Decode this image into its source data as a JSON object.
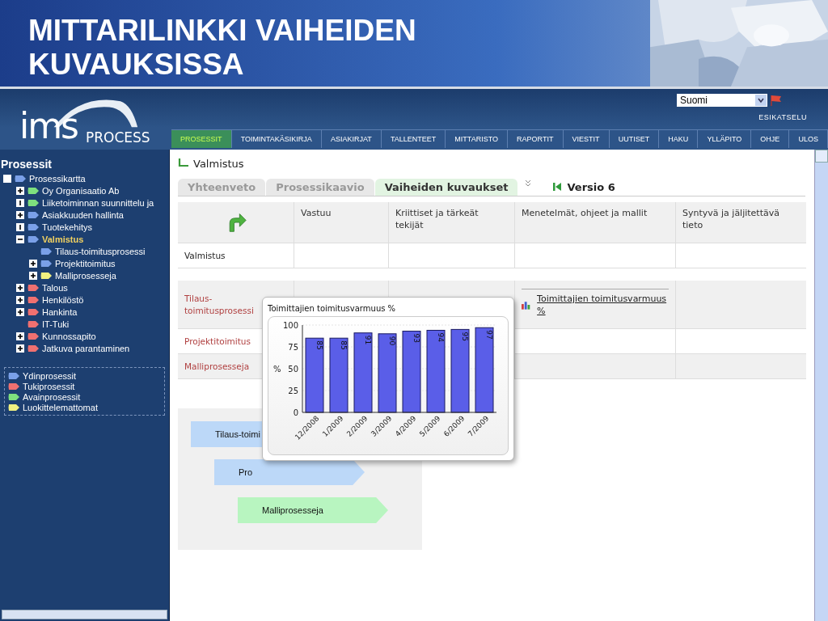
{
  "slide": {
    "title": "MITTARILINKKI VAIHEIDEN KUVAUKSISSA"
  },
  "header": {
    "logo_main": "ims",
    "logo_sub": "PROCESS",
    "language": "Suomi",
    "preview_link": "ESIKATSELU"
  },
  "nav": [
    {
      "label": "PROSESSIT",
      "selected": true
    },
    {
      "label": "TOIMINTAKÄSIKIRJA",
      "selected": false
    },
    {
      "label": "ASIAKIRJAT",
      "selected": false
    },
    {
      "label": "TALLENTEET",
      "selected": false
    },
    {
      "label": "MITTARISTO",
      "selected": false
    },
    {
      "label": "RAPORTIT",
      "selected": false
    },
    {
      "label": "VIESTIT",
      "selected": false
    },
    {
      "label": "UUTISET",
      "selected": false
    },
    {
      "label": "HAKU",
      "selected": false
    },
    {
      "label": "YLLÄPITO",
      "selected": false
    },
    {
      "label": "OHJE",
      "selected": false
    },
    {
      "label": "ULOS",
      "selected": false
    }
  ],
  "sidebar": {
    "title": "Prosessit",
    "tree": [
      {
        "label": "Prosessikartta",
        "kind": "box",
        "color": "#7aa0e8",
        "selected": false,
        "children": [
          {
            "label": "Oy Organisaatio Ab",
            "kind": "plus",
            "color": "#7ee07e",
            "selected": false
          },
          {
            "label": "Liiketoiminnan suunnittelu ja",
            "kind": "line",
            "color": "#7ee07e",
            "selected": false
          },
          {
            "label": "Asiakkuuden hallinta",
            "kind": "plus",
            "color": "#7aa0e8",
            "selected": false
          },
          {
            "label": "Tuotekehitys",
            "kind": "line",
            "color": "#7aa0e8",
            "selected": false
          },
          {
            "label": "Valmistus",
            "kind": "minus",
            "color": "#7aa0e8",
            "selected": true,
            "children": [
              {
                "label": "Tilaus-toimitusprosessi",
                "kind": "leaf",
                "color": "#7aa0e8",
                "selected": false
              },
              {
                "label": "Projektitoimitus",
                "kind": "plus",
                "color": "#7aa0e8",
                "selected": false
              },
              {
                "label": "Malliprosesseja",
                "kind": "plus",
                "color": "#f0f080",
                "selected": false
              }
            ]
          },
          {
            "label": "Talous",
            "kind": "plus",
            "color": "#f07070",
            "selected": false
          },
          {
            "label": "Henkilöstö",
            "kind": "plus",
            "color": "#f07070",
            "selected": false
          },
          {
            "label": "Hankinta",
            "kind": "plus",
            "color": "#f07070",
            "selected": false
          },
          {
            "label": "IT-Tuki",
            "kind": "leaf",
            "color": "#f07070",
            "selected": false
          },
          {
            "label": "Kunnossapito",
            "kind": "plus",
            "color": "#f07070",
            "selected": false
          },
          {
            "label": "Jatkuva parantaminen",
            "kind": "plus",
            "color": "#f07070",
            "selected": false
          }
        ]
      }
    ],
    "legend": [
      {
        "label": "Ydinprosessit",
        "color": "#7aa0e8"
      },
      {
        "label": "Tukiprosessit",
        "color": "#f07070"
      },
      {
        "label": "Avainprosessit",
        "color": "#7ee07e"
      },
      {
        "label": "Luokittelemattomat",
        "color": "#f0f080"
      }
    ]
  },
  "page": {
    "title": "Valmistus",
    "tabs": [
      {
        "label": "Yhteenveto",
        "selected": false
      },
      {
        "label": "Prosessikaavio",
        "selected": false
      },
      {
        "label": "Vaiheiden kuvaukset",
        "selected": true
      }
    ],
    "version": "Versio 6",
    "table": {
      "columns": [
        "Vastuu",
        "Kriittiset ja tärkeät tekijät",
        "Menetelmät, ohjeet ja mallit",
        "Syntyvä ja jäljitettävä tieto"
      ],
      "rows": [
        {
          "name": "Valmistus",
          "kind": "parent"
        },
        {
          "name": "Tilaus-toimitusprosessi",
          "kind": "child",
          "link": "Toimittajien toimitusvarmuus %"
        },
        {
          "name": "Projektitoimitus",
          "kind": "child"
        },
        {
          "name": "Malliprosesseja",
          "kind": "child"
        }
      ]
    },
    "diagram": [
      {
        "label": "Tilaus-toimi",
        "color": "#bcd8f8"
      },
      {
        "label": "Pro",
        "color": "#bcd8f8"
      },
      {
        "label": "Malliprosesseja",
        "color": "#b8f5c0"
      }
    ],
    "popup": {
      "chart_data": {
        "type": "bar",
        "title": "Toimittajien toimitusvarmuus %",
        "ylabel": "%",
        "categories": [
          "12/2008",
          "1/2009",
          "2/2009",
          "3/2009",
          "4/2009",
          "5/2009",
          "6/2009",
          "7/2009"
        ],
        "series": [
          {
            "color": "#5a5ee8",
            "values": [
              85,
              85,
              91,
              90,
              93,
              94,
              95,
              97
            ]
          }
        ],
        "ylim": [
          0,
          100
        ],
        "yticks": [
          0,
          25,
          50,
          75,
          100
        ],
        "grid": true,
        "data_labels": true
      }
    }
  }
}
